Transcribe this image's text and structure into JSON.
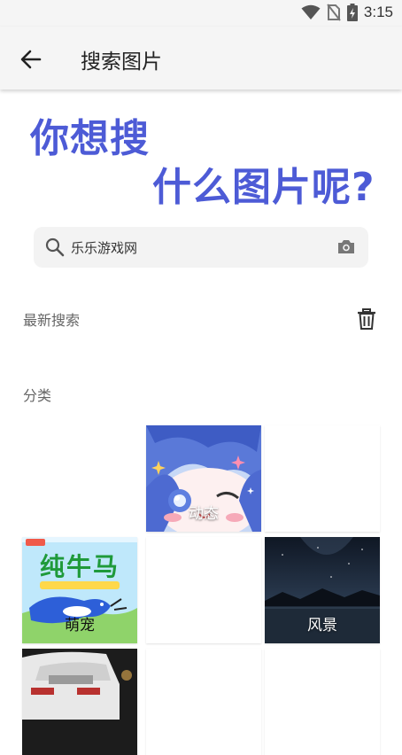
{
  "status": {
    "time": "3:15"
  },
  "appbar": {
    "title": "搜索图片"
  },
  "hero": {
    "line1": "你想搜",
    "line2": "什么图片呢?"
  },
  "search": {
    "value": "乐乐游戏网"
  },
  "recent": {
    "label": "最新搜索"
  },
  "categories": {
    "label": "分类",
    "items": [
      {
        "label": "动态"
      },
      {
        "label": "萌宠",
        "poster_text": "纯牛马"
      },
      {
        "label": "风景"
      }
    ]
  },
  "colors": {
    "accent": "#4d5bd6",
    "appbar_bg": "#f5f5f5"
  }
}
